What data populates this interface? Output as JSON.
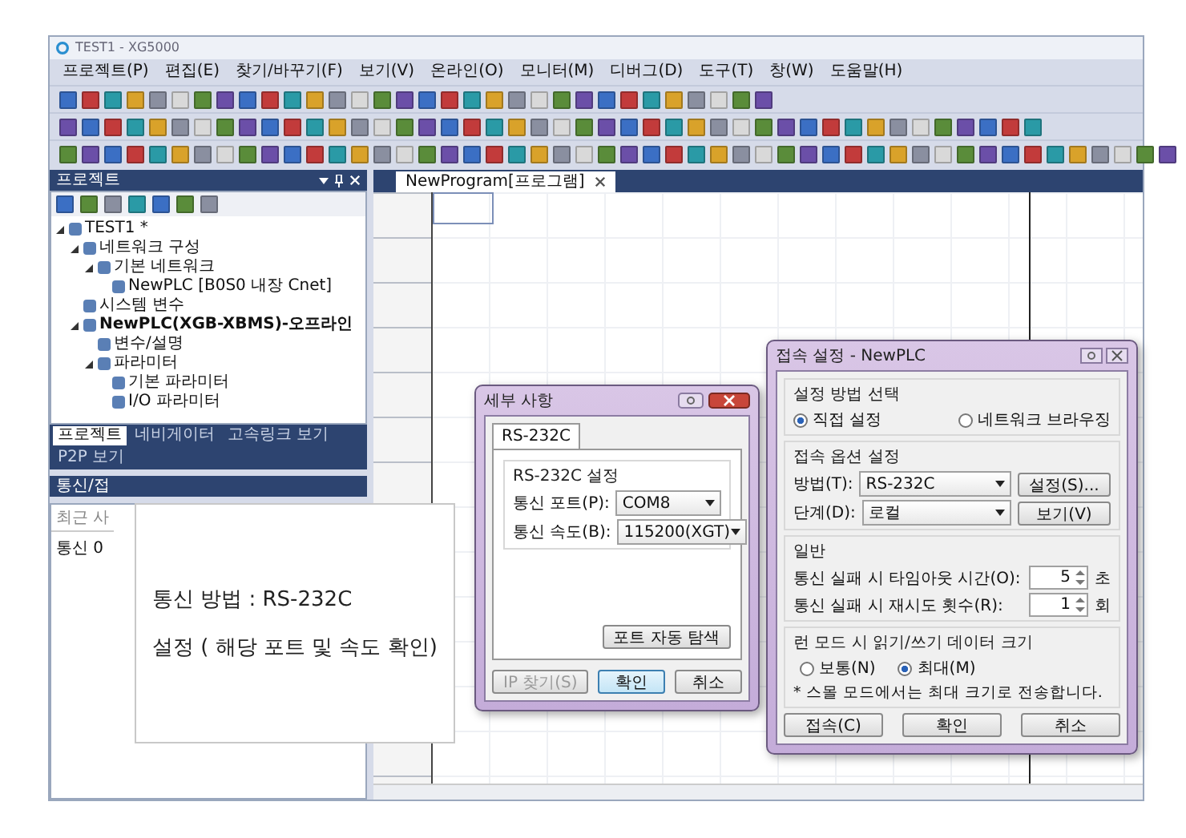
{
  "window": {
    "title": "TEST1 - XG5000"
  },
  "menu": [
    "프로젝트(P)",
    "편집(E)",
    "찾기/바꾸기(F)",
    "보기(V)",
    "온라인(O)",
    "모니터(M)",
    "디버그(D)",
    "도구(T)",
    "창(W)",
    "도움말(H)"
  ],
  "project_panel": {
    "title": "프로젝트",
    "tree": [
      {
        "label": "TEST1 *",
        "expanded": true,
        "children": [
          {
            "label": "네트워크 구성",
            "expanded": true,
            "children": [
              {
                "label": "기본 네트워크",
                "expanded": true,
                "children": [
                  {
                    "label": "NewPLC [B0S0 내장 Cnet]"
                  }
                ]
              }
            ]
          },
          {
            "label": "시스템 변수"
          },
          {
            "label": "NewPLC(XGB-XBMS)-오프라인",
            "emphasis": true,
            "expanded": true,
            "children": [
              {
                "label": "변수/설명"
              },
              {
                "label": "파라미터",
                "expanded": true,
                "children": [
                  {
                    "label": "기본 파라미터"
                  },
                  {
                    "label": "I/O 파라미터"
                  }
                ]
              }
            ]
          }
        ]
      }
    ],
    "tabs": [
      {
        "label": "프로젝트",
        "selected": true
      },
      {
        "label": "네비게이터",
        "selected": false
      },
      {
        "label": "고속링크 보기",
        "selected": false
      },
      {
        "label": "P2P 보기",
        "selected": false
      }
    ]
  },
  "comm_panel": {
    "title": "통신/접",
    "filter": "최근 사",
    "rows": [
      "통신 0"
    ]
  },
  "editor": {
    "tabs": [
      {
        "label": "NewProgram[프로그램]",
        "selected": true
      }
    ]
  },
  "detail_dialog": {
    "title": "세부 사항",
    "tabs": [
      {
        "label": "RS-232C",
        "selected": true
      }
    ],
    "group": "RS-232C 설정",
    "fields": [
      {
        "label": "통신 포트(P):",
        "value": "COM8"
      },
      {
        "label": "통신 속도(B):",
        "value": "115200(XGT)"
      }
    ],
    "auto_button": "포트 자동 탐색",
    "buttons": [
      {
        "label": "IP 찾기(S)",
        "disabled": true,
        "focused": false
      },
      {
        "label": "확인",
        "disabled": false,
        "focused": true
      },
      {
        "label": "취소",
        "disabled": false,
        "focused": false
      }
    ]
  },
  "connect_dialog": {
    "title": "접속 설정 - NewPLC",
    "method_group": {
      "title": "설정 방법 선택",
      "options": [
        {
          "label": "직접 설정",
          "selected": true
        },
        {
          "label": "네트워크 브라우징",
          "selected": false
        }
      ]
    },
    "option_group": {
      "title": "접속 옵션 설정",
      "rows": [
        {
          "label": "방법(T):",
          "value": "RS-232C",
          "button": "설정(S)..."
        },
        {
          "label": "단계(D):",
          "value": "로컬",
          "button": "보기(V)"
        }
      ]
    },
    "general_group": {
      "title": "일반",
      "spins": [
        {
          "label": "통신 실패 시 타임아웃 시간(O):",
          "value": "5",
          "unit": "초"
        },
        {
          "label": "통신 실패 시 재시도 횟수(R):",
          "value": "1",
          "unit": "회"
        }
      ]
    },
    "run_mode_group": {
      "title": "런 모드 시 읽기/쓰기 데이터 크기",
      "options": [
        {
          "label": "보통(N)",
          "selected": false
        },
        {
          "label": "최대(M)",
          "selected": true
        }
      ],
      "note": "* 스몰 모드에서는 최대 크기로 전송합니다."
    },
    "buttons": [
      "접속(C)",
      "확인",
      "취소"
    ]
  },
  "callout": {
    "lines": [
      "통신 방법 : RS-232C",
      "설정 ( 해당 포트 및 속도 확인)"
    ]
  }
}
